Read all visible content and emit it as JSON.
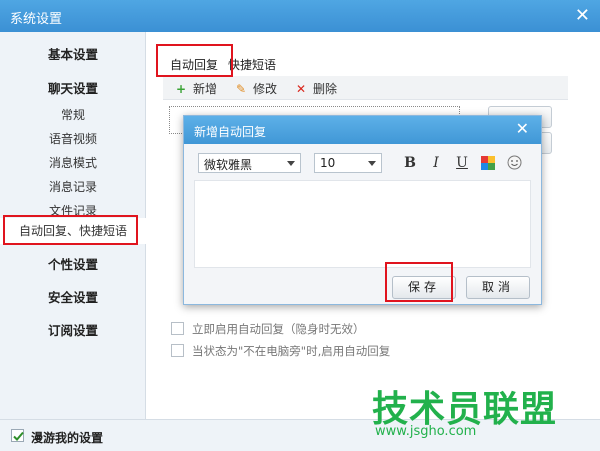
{
  "window": {
    "title": "系统设置",
    "close": "✕"
  },
  "sidebar": {
    "sections": {
      "basic": "基本设置",
      "chat": "聊天设置",
      "personal": "个性设置",
      "security": "安全设置",
      "subscribe": "订阅设置"
    },
    "items": [
      "常规",
      "语音视频",
      "消息模式",
      "消息记录",
      "文件记录",
      "自动回复、快捷短语"
    ]
  },
  "tabs": [
    "自动回复",
    "快捷短语"
  ],
  "toolbar": {
    "add": "新增",
    "edit": "修改",
    "delete": "删除"
  },
  "options": {
    "enable_now": "立即启用自动回复（隐身时无效）",
    "away_enable": "当状态为\"不在电脑旁\"时,启用自动回复"
  },
  "footer": {
    "roam": "漫游我的设置"
  },
  "dialog": {
    "title": "新增自动回复",
    "font": "微软雅黑",
    "size": "10",
    "bold": "B",
    "italic": "I",
    "underline": "U",
    "save": "保存",
    "cancel": "取消"
  },
  "watermark": {
    "text": "技术员联盟",
    "url": "www.jsgho.com"
  },
  "colors": {
    "titlebar": "#3b90d4",
    "highlight": "#e0141e",
    "watermark": "#22b14c"
  }
}
